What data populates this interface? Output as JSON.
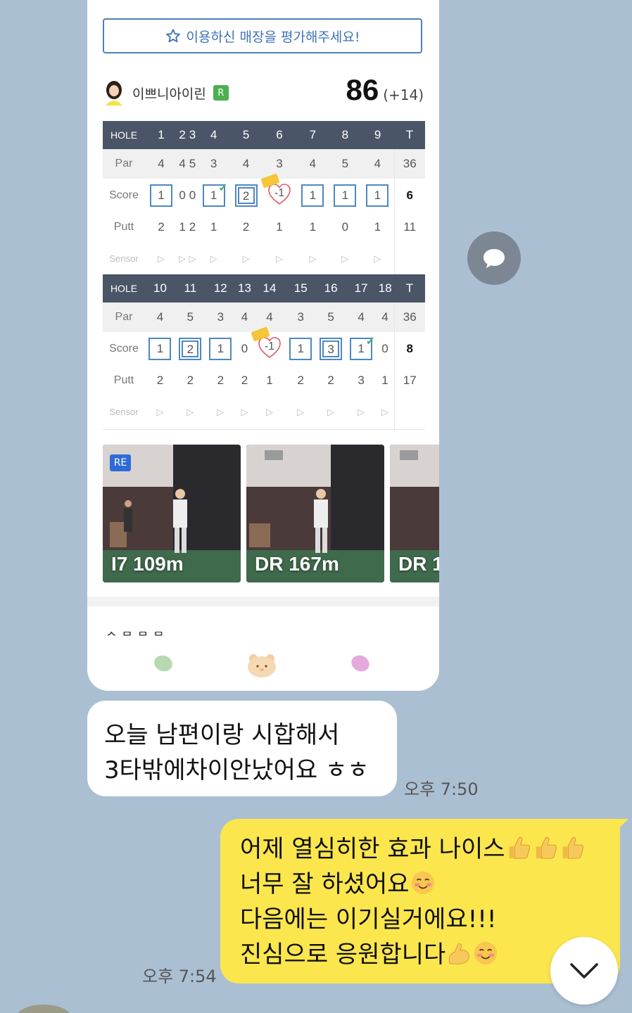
{
  "card": {
    "rate_button": "이용하신 매장을 평가해주세요!",
    "player_name": "이쁘니아이린",
    "badge": "R",
    "total": "86",
    "total_diff": "(+14)",
    "front": {
      "header": [
        "HOLE",
        "1",
        "2",
        "3",
        "4",
        "5",
        "6",
        "7",
        "8",
        "9",
        "T"
      ],
      "par": [
        "Par",
        "4",
        "4",
        "5",
        "3",
        "4",
        "3",
        "4",
        "5",
        "4",
        "36"
      ],
      "score": [
        "Score",
        "1",
        "0",
        "0",
        "1",
        "2",
        "-1",
        "1",
        "1",
        "1",
        "6"
      ],
      "putt": [
        "Putt",
        "2",
        "1",
        "2",
        "1",
        "2",
        "1",
        "1",
        "0",
        "1",
        "11"
      ],
      "sensor_label": "Sensor"
    },
    "back": {
      "header": [
        "HOLE",
        "10",
        "11",
        "12",
        "13",
        "14",
        "15",
        "16",
        "17",
        "18",
        "T"
      ],
      "par": [
        "Par",
        "4",
        "5",
        "3",
        "4",
        "4",
        "3",
        "5",
        "4",
        "4",
        "36"
      ],
      "score": [
        "Score",
        "1",
        "2",
        "1",
        "0",
        "-1",
        "1",
        "3",
        "1",
        "0",
        "8"
      ],
      "putt": [
        "Putt",
        "2",
        "2",
        "2",
        "2",
        "1",
        "2",
        "2",
        "3",
        "1",
        "17"
      ],
      "sensor_label": "Sensor"
    },
    "thumbnails": [
      {
        "label": "I7 109m",
        "badge": "RE"
      },
      {
        "label": "DR 167m"
      },
      {
        "label": "DR 1"
      }
    ],
    "cut_text": "ㅅ ㅂ ㅂ ㅂ"
  },
  "messages": {
    "left": {
      "line1": "오늘 남편이랑 시합해서",
      "line2": "3타밖에차이안났어요 ㅎㅎ",
      "time": "오후 7:50"
    },
    "right": {
      "line1": "어제 열심히한 효과 나이스",
      "line2": "너무 잘 하셨어요",
      "line3": "다음에는 이기실거에요!!!",
      "line4": "진심으로 응원합니다",
      "time": "오후 7:54"
    }
  },
  "icons": {
    "chat": "chat-bubble-icon",
    "scroll_down": "chevron-down-icon",
    "thumbs_up": "thumbs-up-emoji",
    "smile": "smiling-face-emoji",
    "muscle": "flexed-biceps-emoji"
  },
  "colors": {
    "background": "#abbfd3",
    "my_bubble": "#fbe64e",
    "table_header": "#4a5567",
    "accent_blue": "#4d7fbf"
  }
}
